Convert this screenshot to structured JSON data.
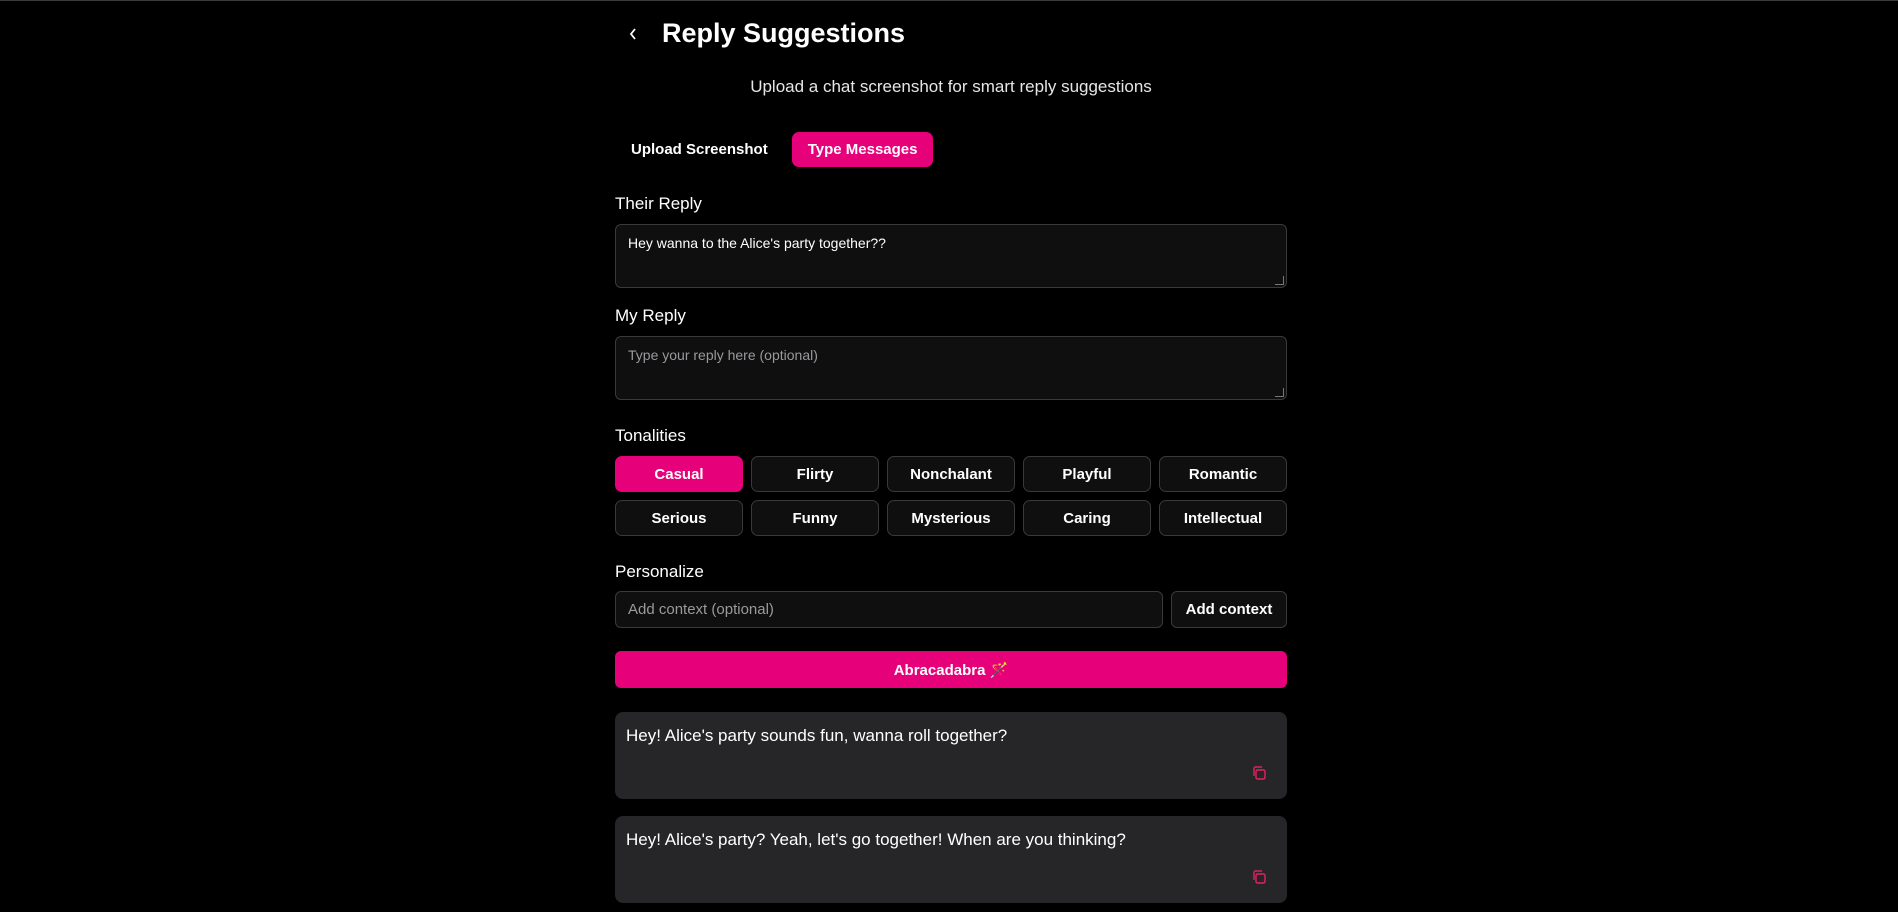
{
  "header": {
    "back_icon": "chevron-left-icon",
    "title": "Reply Suggestions",
    "subtitle": "Upload a chat screenshot for smart reply suggestions"
  },
  "tabs": [
    {
      "label": "Upload Screenshot",
      "active": false
    },
    {
      "label": "Type Messages",
      "active": true
    }
  ],
  "their_reply": {
    "label": "Their Reply",
    "value": "Hey wanna to the Alice's party together??"
  },
  "my_reply": {
    "label": "My Reply",
    "placeholder": "Type your reply here (optional)"
  },
  "tonalities": {
    "label": "Tonalities",
    "items": [
      "Casual",
      "Flirty",
      "Nonchalant",
      "Playful",
      "Romantic",
      "Serious",
      "Funny",
      "Mysterious",
      "Caring",
      "Intellectual"
    ],
    "selected": "Casual"
  },
  "personalize": {
    "label": "Personalize",
    "placeholder": "Add context (optional)",
    "button": "Add context"
  },
  "generate_button": "Abracadabra 🪄",
  "suggestions": [
    {
      "text": "Hey! Alice's party sounds fun, wanna roll together?"
    },
    {
      "text": "Hey! Alice's party? Yeah, let's go together! When are you thinking?"
    }
  ],
  "colors": {
    "accent": "#e6007a",
    "copy_icon": "#e0245e"
  }
}
